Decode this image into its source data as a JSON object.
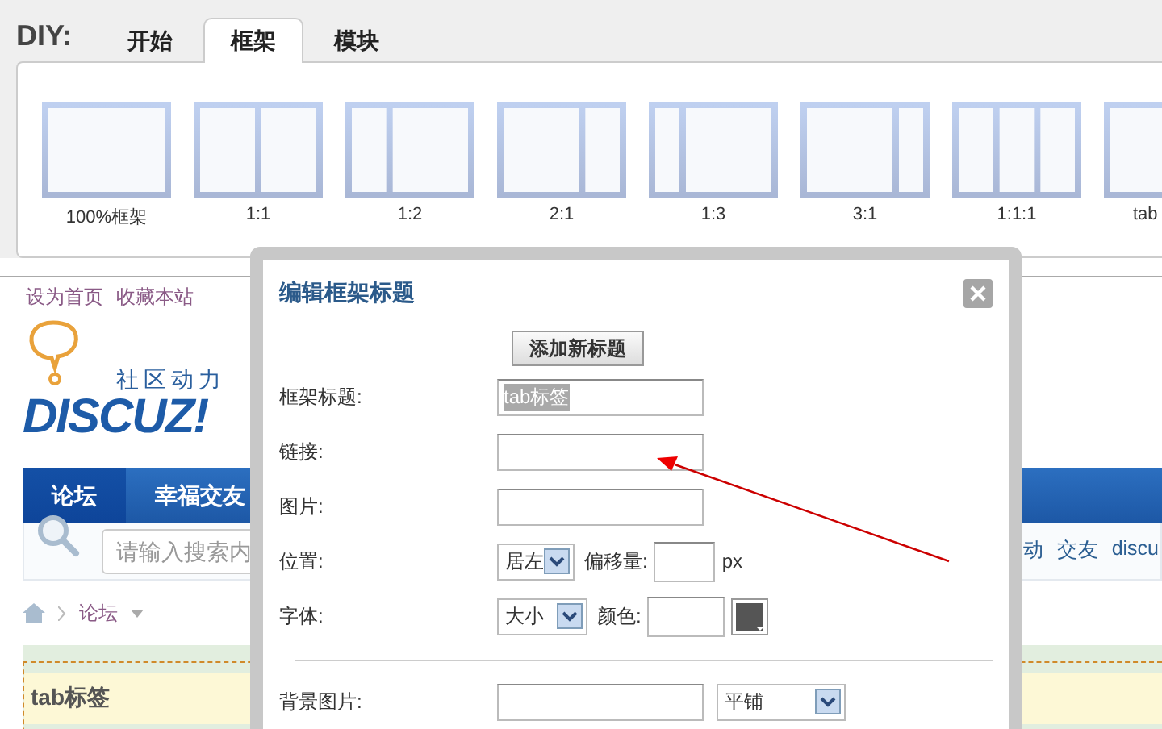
{
  "diy_bar": {
    "label": "DIY:",
    "tabs": [
      {
        "label": "开始",
        "selected": false
      },
      {
        "label": "框架",
        "selected": true
      },
      {
        "label": "模块",
        "selected": false
      }
    ],
    "frames": [
      {
        "label": "100%框架",
        "kind": "single"
      },
      {
        "label": "1:1",
        "kind": "halves"
      },
      {
        "label": "1:2",
        "kind": "narrow-wide"
      },
      {
        "label": "2:1",
        "kind": "wide-narrow"
      },
      {
        "label": "1:3",
        "kind": "quarter-left"
      },
      {
        "label": "3:1",
        "kind": "quarter-right"
      },
      {
        "label": "1:1:1",
        "kind": "thirds"
      },
      {
        "label": "tab",
        "kind": "tab"
      }
    ]
  },
  "page": {
    "top_links": [
      "设为首页",
      "收藏本站"
    ],
    "logo": {
      "slogan": "社区动力",
      "wordmark": "DISCUZ!"
    },
    "nav": [
      {
        "label": "论坛",
        "selected": true
      },
      {
        "label": "幸福交友",
        "selected": false
      }
    ],
    "search": {
      "placeholder": "请输入搜索内"
    },
    "quick_links": [
      "动",
      "交友",
      "discu"
    ],
    "breadcrumb": [
      "论坛"
    ],
    "frame_title": "tab标签"
  },
  "dialog": {
    "title": "编辑框架标题",
    "add_button": "添加新标题",
    "fields": [
      {
        "kind": "text",
        "label": "框架标题:",
        "value": "tab标签",
        "text_selected": true
      },
      {
        "kind": "text",
        "label": "链接:"
      },
      {
        "kind": "text",
        "label": "图片:"
      },
      {
        "kind": "position",
        "label": "位置:",
        "select": "居左",
        "offset_label": "偏移量:",
        "unit": "px"
      },
      {
        "kind": "font",
        "label": "字体:",
        "select": "大小",
        "color_label": "颜色:"
      }
    ],
    "background": {
      "label": "背景图片:",
      "repeat": "平铺"
    }
  }
}
